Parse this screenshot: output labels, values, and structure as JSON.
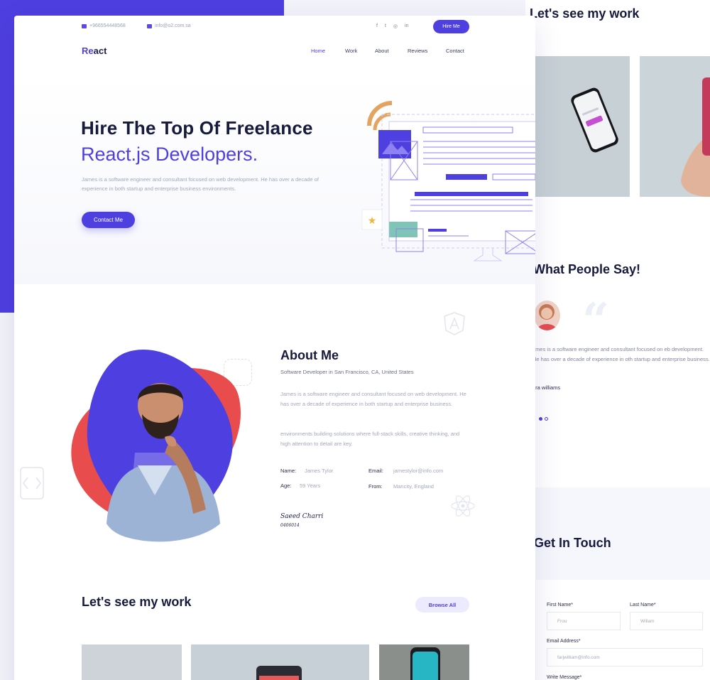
{
  "topbar": {
    "phone": "+966554448568",
    "email": "info@o2.com.sa",
    "socials": [
      "f",
      "t",
      "◎",
      "in"
    ],
    "hire_label": "Hire Me"
  },
  "brand": {
    "logo_re": "Re",
    "logo_rest": "act"
  },
  "nav": {
    "items": [
      "Home",
      "Work",
      "About",
      "Reviews",
      "Contact"
    ],
    "active": "Home"
  },
  "hero": {
    "title_line1": "Hire The Top Of Freelance",
    "title_line2": "React.js Developers.",
    "description": "James is a software engineer and consultant focused on web development. He has over a decade of experience in both startup and enterprise business environments.",
    "cta": "Contact Me"
  },
  "about": {
    "title": "About Me",
    "subtitle": "Software Developer in San Francisco, CA, United States",
    "paragraph1": "James is a software engineer and consultant focused on web development. He has over a decade of experience in both startup and enterprise business.",
    "paragraph2": "environments building solutions where full-stack skills, creative thinking, and high attention to detail are key.",
    "info": [
      {
        "key": "Name:",
        "value": "James Tylor"
      },
      {
        "key": "Email:",
        "value": "jamestylor@info.com"
      },
      {
        "key": "Age:",
        "value": "59 Years"
      },
      {
        "key": "From:",
        "value": "Mancity, England"
      }
    ],
    "signature": "Saeed Charri",
    "signature_sub": "0406014"
  },
  "work": {
    "title": "Let's see my work",
    "browse_label": "Browse All"
  },
  "side": {
    "work_title": "Let's see my work",
    "testimonials_title": "What People Say!",
    "testimonial_text": "James is a software engineer and consultant focused on web development. He has over a decade of experience in both startup and enterprise business.",
    "testimonial_visible": "omes is a software engineer and consultant focused on eb development. He has over a decade of experience in oth startup and enterprise business.",
    "testimonial_author": "ora williams",
    "contact_title": "Get In Touch",
    "form": {
      "first_name_label": "First Name*",
      "first_name_value": "Frou",
      "last_name_label": "Last Name*",
      "last_name_value": "Willam",
      "email_label": "Email Address*",
      "email_value": "farjwilliam@info.com",
      "message_label": "Write Message*"
    }
  },
  "colors": {
    "accent": "#4e3fe0",
    "heading": "#161a3d",
    "muted": "#a3a8bb",
    "blob_red": "#e84c4c"
  }
}
